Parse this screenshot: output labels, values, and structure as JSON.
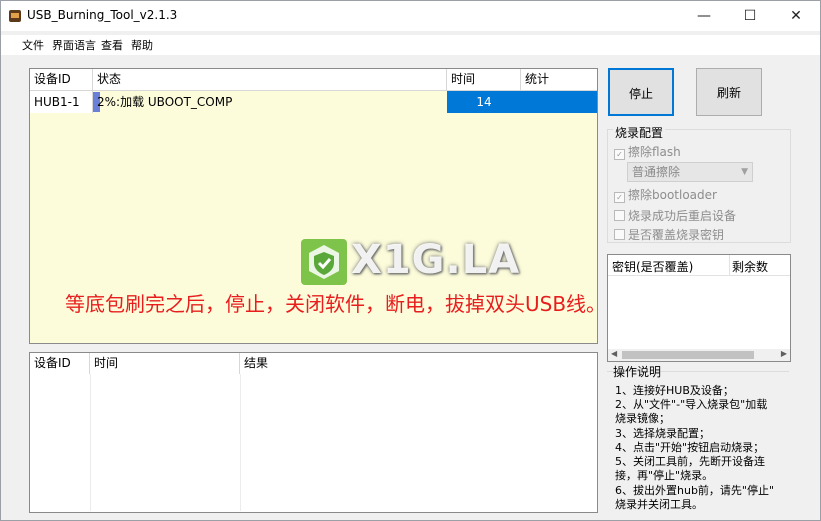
{
  "window": {
    "title": "USB_Burning_Tool_v2.1.3",
    "controls": {
      "minimize": "—",
      "maximize": "☐",
      "close": "✕"
    }
  },
  "menu": [
    "文件",
    "界面语言",
    "查看",
    "帮助"
  ],
  "device_table": {
    "columns": [
      "设备ID",
      "状态",
      "时间",
      "统计"
    ],
    "rows": [
      {
        "device_id": "HUB1-1",
        "status": "2%:加载 UBOOT_COMP",
        "progress": 0.02,
        "time": "14",
        "stats": ""
      }
    ]
  },
  "result_table": {
    "columns": [
      "设备ID",
      "时间",
      "结果"
    ]
  },
  "buttons": {
    "stop": "停止",
    "refresh": "刷新"
  },
  "burn_config": {
    "title": "烧录配置",
    "erase_flash": {
      "label": "擦除flash",
      "checked": true
    },
    "erase_mode": "普通擦除",
    "erase_bootloader": {
      "label": "擦除bootloader",
      "checked": true
    },
    "reboot_after": {
      "label": "烧录成功后重启设备",
      "checked": false
    },
    "overwrite_key": {
      "label": "是否覆盖烧录密钥",
      "checked": false
    }
  },
  "key_table": {
    "columns": [
      "密钥(是否覆盖)",
      "剩余数"
    ]
  },
  "help": {
    "title": "操作说明",
    "lines": [
      "1、连接好HUB及设备；",
      "2、从\"文件\"-\"导入烧录包\"加载",
      "烧录镜像；",
      "3、选择烧录配置；",
      "4、点击\"开始\"按钮启动烧录；",
      "5、关闭工具前，先断开设备连",
      "接，再\"停止\"烧录。",
      "6、拔出外置hub前，请先\"停止\"",
      "烧录并关闭工具。"
    ]
  },
  "watermark": "X1G.LA",
  "overlay_note": "等底包刷完之后，停止，关闭软件，断电，拔掉双头USB线。",
  "colors": {
    "accent": "#0078d7",
    "time_cell": "#0078d7",
    "note": "#e81e1e"
  }
}
